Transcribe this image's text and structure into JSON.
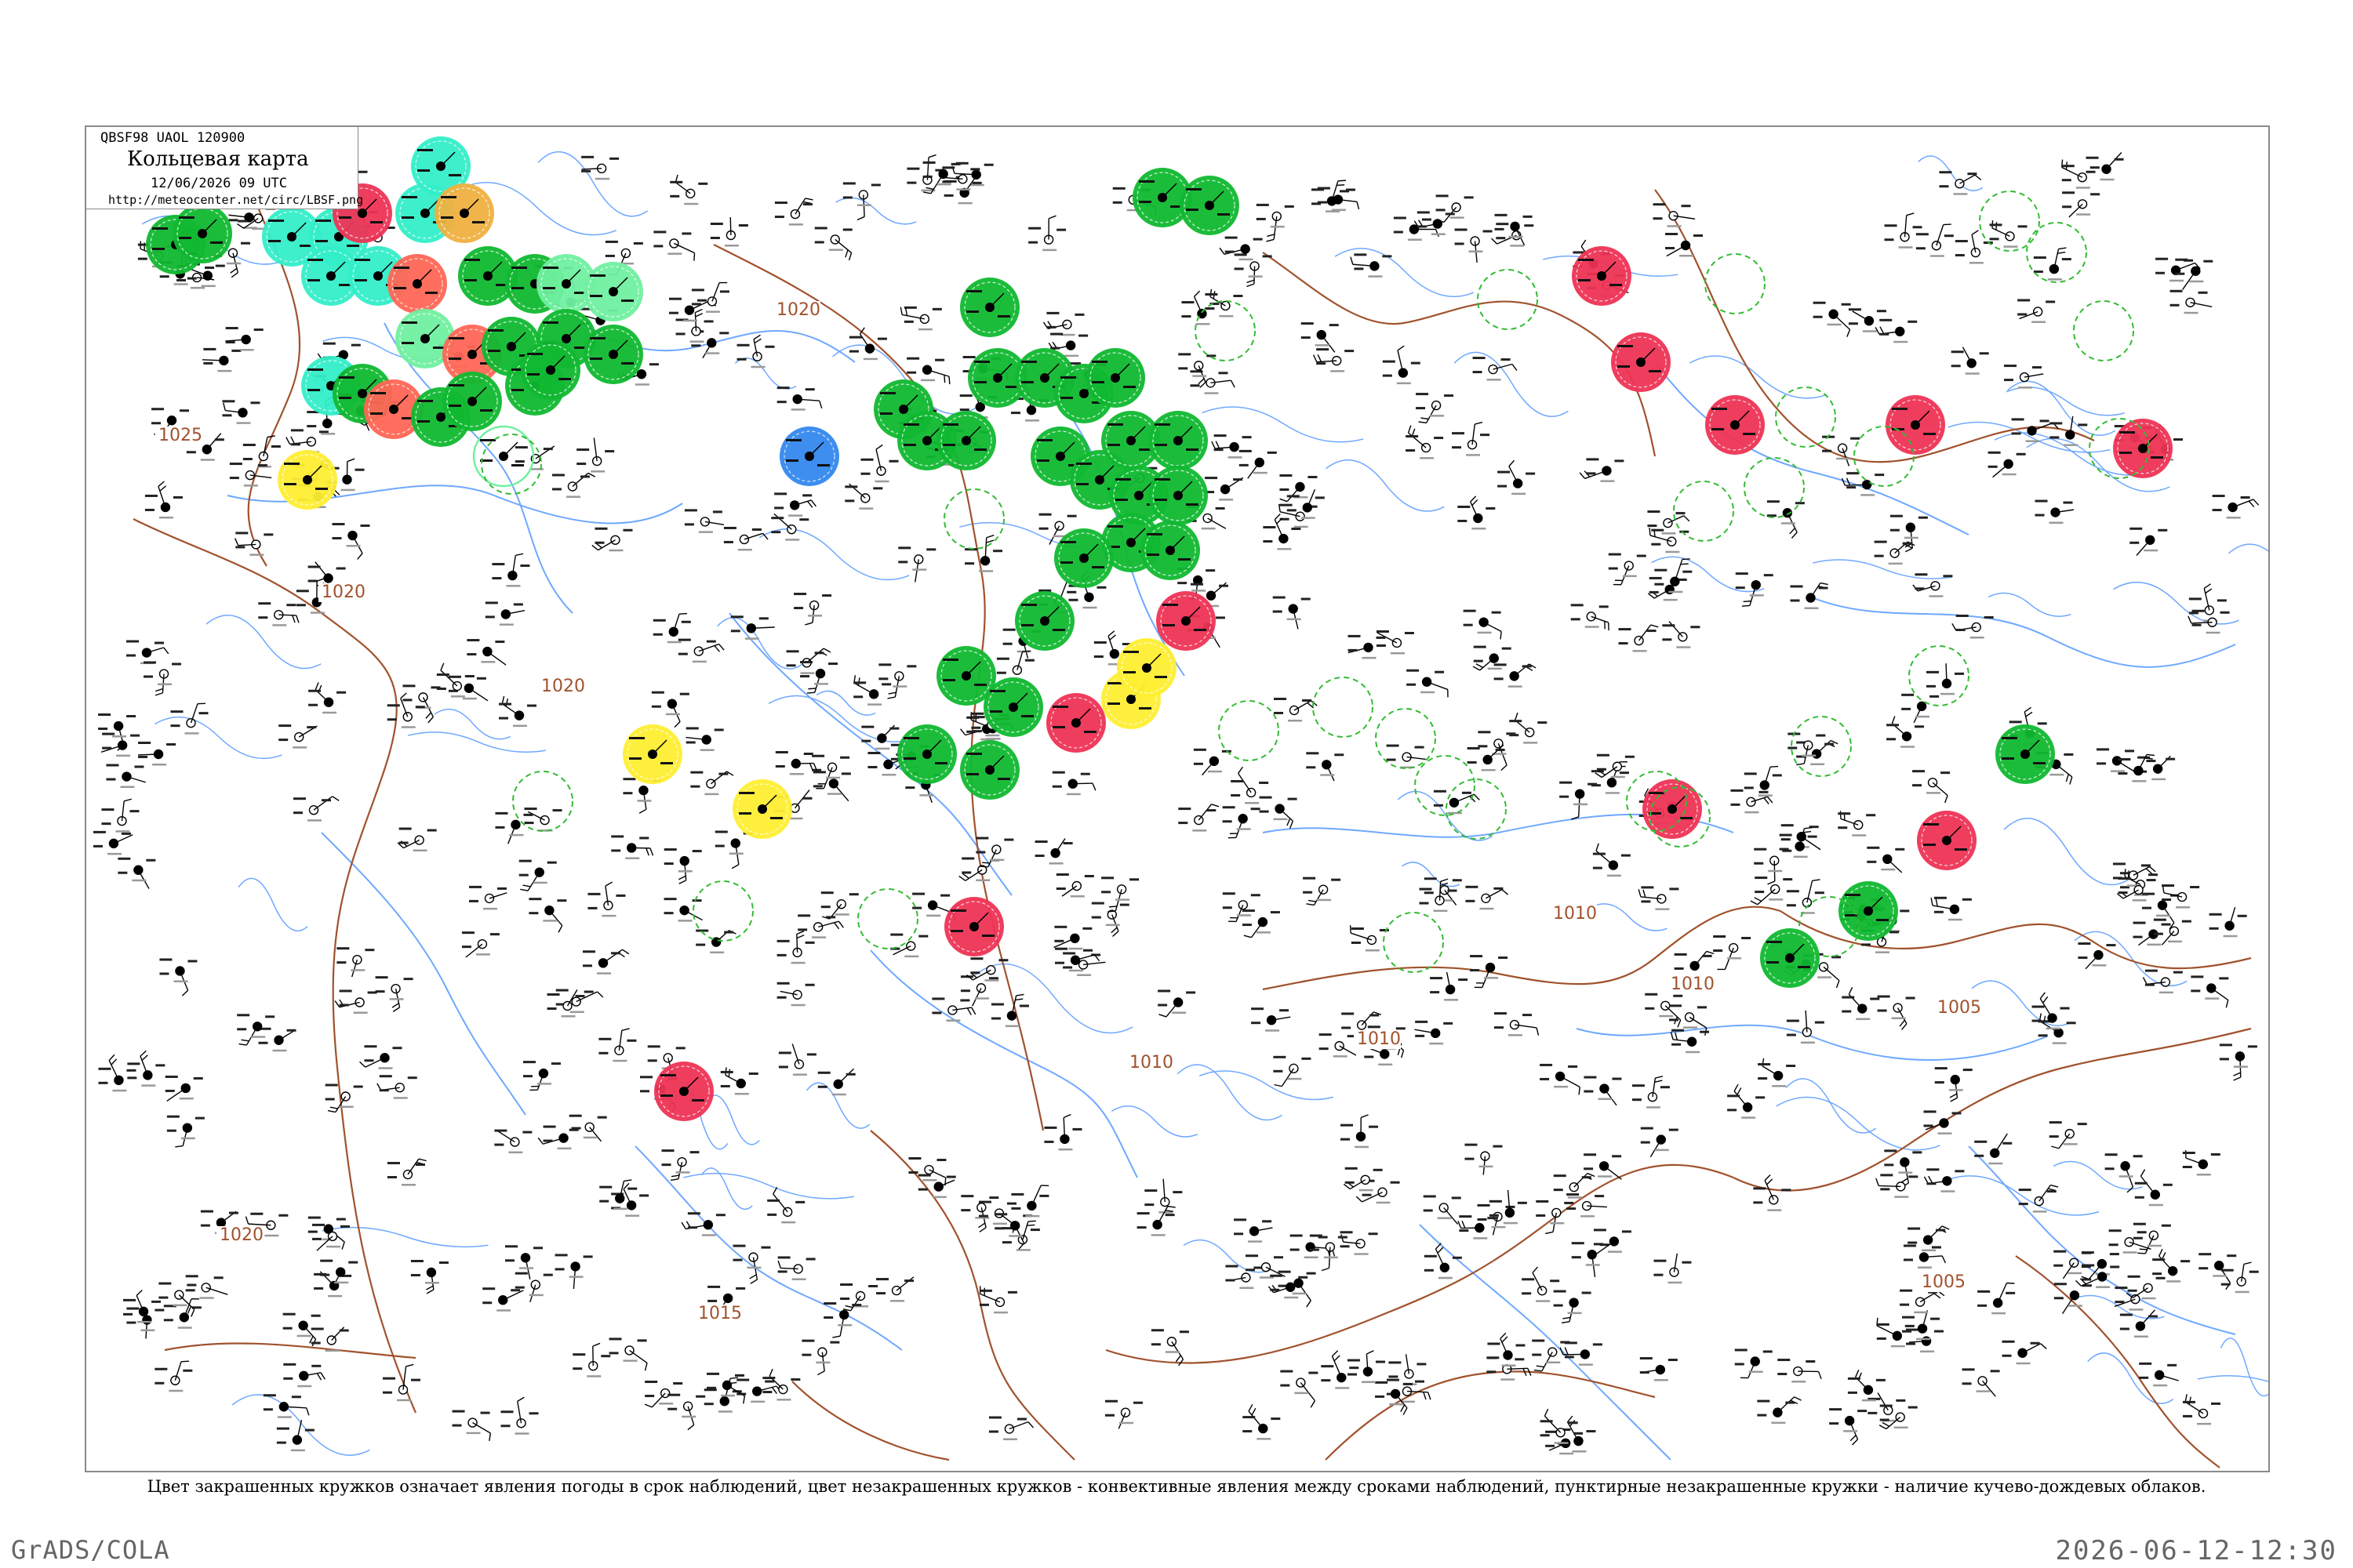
{
  "header": {
    "code": "QBSF98 UAOL 120900",
    "title": "Кольцевая карта",
    "date": "12/06/2026 09 UTC",
    "url": "http://meteocenter.net/circ/LBSF.png"
  },
  "caption": "Цвет закрашенных кружков означает явления погоды в срок наблюдений, цвет незакрашенных кружков - конвективные явления между сроками наблюдений, пунктирные незакрашенные кружки - наличие кучево-дождевых облаков.",
  "footer": {
    "software": "GrADS/COLA",
    "timestamp": "2026-06-12-12:30"
  },
  "isobar_labels": [
    "1025",
    "1020",
    "1020",
    "1020",
    "1015",
    "1010",
    "1010",
    "1010",
    "1010",
    "1005",
    "1005",
    "1020"
  ],
  "colors": {
    "isobar": "#a0522d",
    "river": "#6fa8ff",
    "rain": "#10b830",
    "thunder": "#ee3355",
    "shower": "#ff6655",
    "fog": "#ffee33",
    "snow": "#33eec8",
    "drizzle": "#70f0a0",
    "hail": "#3388ee",
    "dust": "#f0b040",
    "cb_ring": "#33bb33"
  }
}
